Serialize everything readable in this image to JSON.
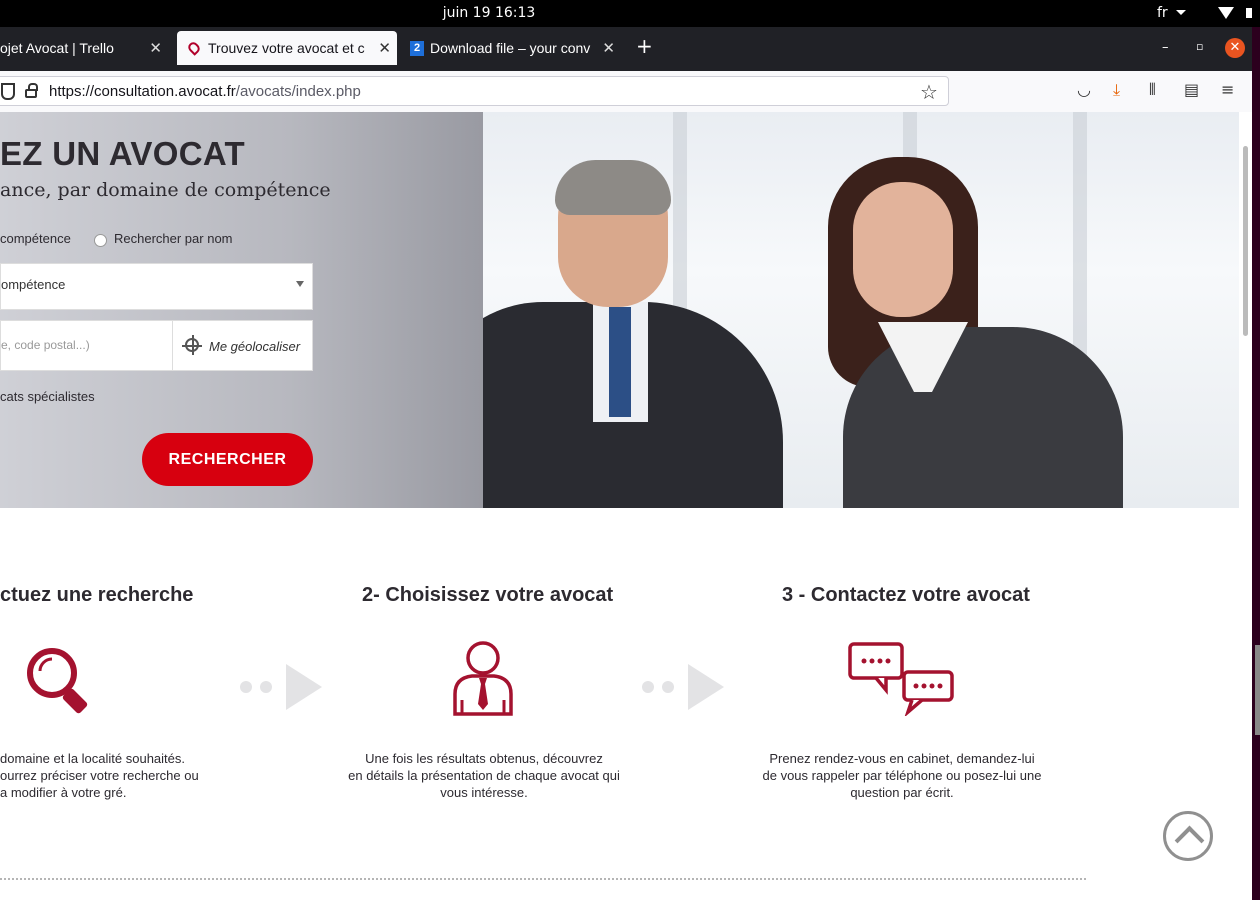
{
  "os": {
    "clock": "juin 19  16:13",
    "lang": "fr"
  },
  "tabs": [
    {
      "title": "ojet Avocat | Trello"
    },
    {
      "title": "Trouvez votre avocat et c"
    },
    {
      "title": "Download file – your conv"
    }
  ],
  "address_bar": {
    "url_host": "https://consultation.avocat.fr",
    "url_path": "/avocats/index.php"
  },
  "hero": {
    "title": "EZ UN AVOCAT",
    "subtitle": "ance, par domaine de compétence",
    "radio_competence": "compétence",
    "radio_name": "Rechercher par nom",
    "select_value": "ompétence",
    "location_placeholder": "e, code postal...)",
    "geolocate": "Me géolocaliser",
    "specialists": "cats spécialistes",
    "search_button": "RECHERCHER"
  },
  "steps": [
    {
      "title": "ctuez une recherche",
      "desc": [
        "domaine et la localité souhaités.",
        "ourrez préciser votre recherche ou",
        "a modifier à votre gré."
      ]
    },
    {
      "title": "2- Choisissez votre avocat",
      "desc": [
        "Une fois les résultats obtenus, découvrez",
        "en détails la présentation de chaque avocat qui",
        "vous intéresse."
      ]
    },
    {
      "title": "3 - Contactez votre avocat",
      "desc": [
        "Prenez rendez-vous en cabinet, demandez-lui",
        "de vous rappeler par téléphone ou posez-lui une",
        "question par écrit."
      ]
    }
  ],
  "colors": {
    "accent": "#d7000f",
    "icon": "#a4122f",
    "tabbar": "#202126"
  },
  "icons": [
    "search-icon",
    "person-icon",
    "chat-bubbles-icon",
    "back-to-top-icon"
  ]
}
